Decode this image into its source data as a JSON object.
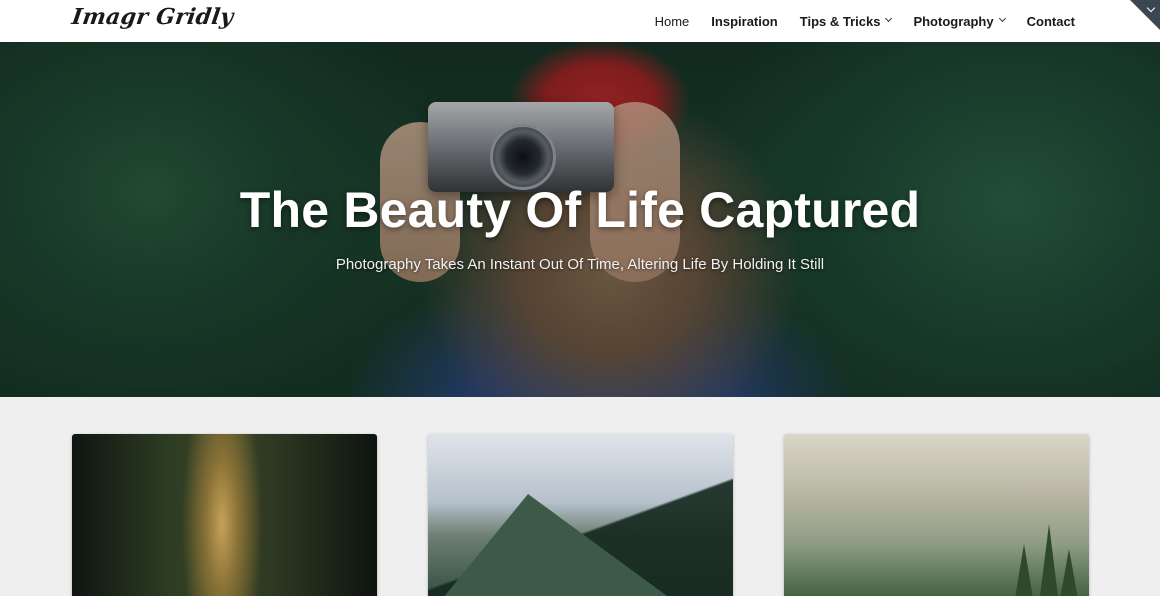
{
  "header": {
    "logo": "Imagr Gridly",
    "nav": {
      "home": "Home",
      "inspiration": "Inspiration",
      "tips": "Tips & Tricks",
      "photography": "Photography",
      "contact": "Contact"
    },
    "icons": {
      "corner": "chevron-down-icon",
      "dropdown": "chevron-down-icon"
    }
  },
  "hero": {
    "title": "The Beauty Of Life Captured",
    "subtitle": "Photography Takes An Instant Out Of Time, Altering Life By Holding It Still"
  },
  "colors": {
    "header_bg": "#ffffff",
    "page_bg": "#efefef",
    "corner_badge": "#3b4651",
    "hero_text": "#ffffff"
  },
  "cards": {
    "items": [
      {
        "subject": "forest-light-photo"
      },
      {
        "subject": "mountain-clouds-photo"
      },
      {
        "subject": "lake-trees-photo"
      }
    ]
  }
}
